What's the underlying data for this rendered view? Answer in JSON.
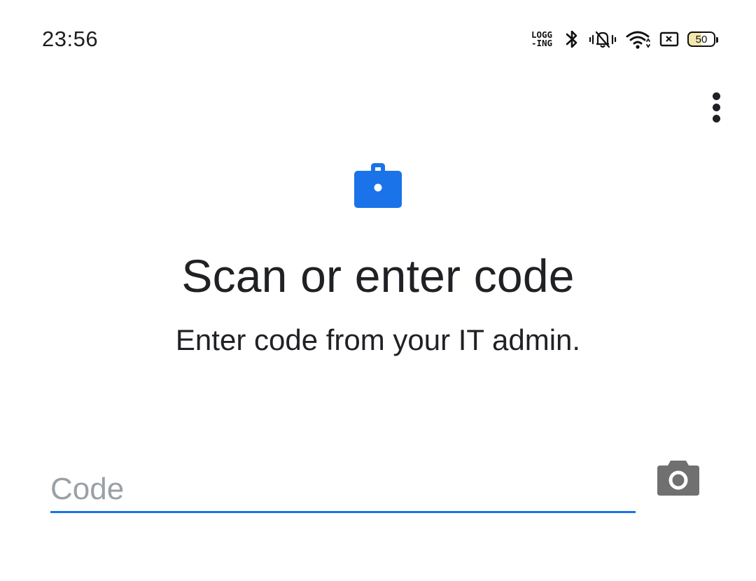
{
  "status_bar": {
    "time": "23:56",
    "logging_badge": "LOGG\n-ING",
    "battery_level": "50",
    "icons": [
      "logging-icon",
      "bluetooth-icon",
      "bell-muted-icon",
      "wifi-icon",
      "notification-box-icon",
      "battery-icon"
    ]
  },
  "toolbar": {
    "overflow_menu_icon": "more-vert-icon"
  },
  "header": {
    "icon": "briefcase-icon",
    "icon_color": "#1a73e8",
    "title": "Scan or enter code",
    "subtitle": "Enter code from your IT admin."
  },
  "form": {
    "code_value": "",
    "code_placeholder": "Code",
    "underline_color": "#1a73e8",
    "camera_icon": "camera-icon",
    "camera_icon_color": "#707070"
  }
}
